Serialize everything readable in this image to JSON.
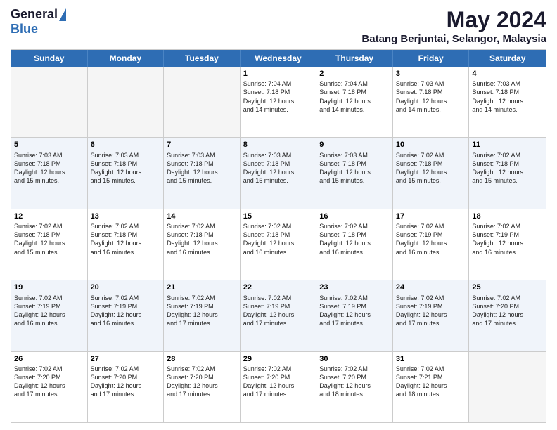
{
  "logo": {
    "general": "General",
    "blue": "Blue"
  },
  "title": "May 2024",
  "subtitle": "Batang Berjuntai, Selangor, Malaysia",
  "days": [
    "Sunday",
    "Monday",
    "Tuesday",
    "Wednesday",
    "Thursday",
    "Friday",
    "Saturday"
  ],
  "rows": [
    [
      {
        "day": "",
        "empty": true
      },
      {
        "day": "",
        "empty": true
      },
      {
        "day": "",
        "empty": true
      },
      {
        "day": "1",
        "lines": [
          "Sunrise: 7:04 AM",
          "Sunset: 7:18 PM",
          "Daylight: 12 hours",
          "and 14 minutes."
        ]
      },
      {
        "day": "2",
        "lines": [
          "Sunrise: 7:04 AM",
          "Sunset: 7:18 PM",
          "Daylight: 12 hours",
          "and 14 minutes."
        ]
      },
      {
        "day": "3",
        "lines": [
          "Sunrise: 7:03 AM",
          "Sunset: 7:18 PM",
          "Daylight: 12 hours",
          "and 14 minutes."
        ]
      },
      {
        "day": "4",
        "lines": [
          "Sunrise: 7:03 AM",
          "Sunset: 7:18 PM",
          "Daylight: 12 hours",
          "and 14 minutes."
        ]
      }
    ],
    [
      {
        "day": "5",
        "lines": [
          "Sunrise: 7:03 AM",
          "Sunset: 7:18 PM",
          "Daylight: 12 hours",
          "and 15 minutes."
        ]
      },
      {
        "day": "6",
        "lines": [
          "Sunrise: 7:03 AM",
          "Sunset: 7:18 PM",
          "Daylight: 12 hours",
          "and 15 minutes."
        ]
      },
      {
        "day": "7",
        "lines": [
          "Sunrise: 7:03 AM",
          "Sunset: 7:18 PM",
          "Daylight: 12 hours",
          "and 15 minutes."
        ]
      },
      {
        "day": "8",
        "lines": [
          "Sunrise: 7:03 AM",
          "Sunset: 7:18 PM",
          "Daylight: 12 hours",
          "and 15 minutes."
        ]
      },
      {
        "day": "9",
        "lines": [
          "Sunrise: 7:03 AM",
          "Sunset: 7:18 PM",
          "Daylight: 12 hours",
          "and 15 minutes."
        ]
      },
      {
        "day": "10",
        "lines": [
          "Sunrise: 7:02 AM",
          "Sunset: 7:18 PM",
          "Daylight: 12 hours",
          "and 15 minutes."
        ]
      },
      {
        "day": "11",
        "lines": [
          "Sunrise: 7:02 AM",
          "Sunset: 7:18 PM",
          "Daylight: 12 hours",
          "and 15 minutes."
        ]
      }
    ],
    [
      {
        "day": "12",
        "lines": [
          "Sunrise: 7:02 AM",
          "Sunset: 7:18 PM",
          "Daylight: 12 hours",
          "and 15 minutes."
        ]
      },
      {
        "day": "13",
        "lines": [
          "Sunrise: 7:02 AM",
          "Sunset: 7:18 PM",
          "Daylight: 12 hours",
          "and 16 minutes."
        ]
      },
      {
        "day": "14",
        "lines": [
          "Sunrise: 7:02 AM",
          "Sunset: 7:18 PM",
          "Daylight: 12 hours",
          "and 16 minutes."
        ]
      },
      {
        "day": "15",
        "lines": [
          "Sunrise: 7:02 AM",
          "Sunset: 7:18 PM",
          "Daylight: 12 hours",
          "and 16 minutes."
        ]
      },
      {
        "day": "16",
        "lines": [
          "Sunrise: 7:02 AM",
          "Sunset: 7:18 PM",
          "Daylight: 12 hours",
          "and 16 minutes."
        ]
      },
      {
        "day": "17",
        "lines": [
          "Sunrise: 7:02 AM",
          "Sunset: 7:19 PM",
          "Daylight: 12 hours",
          "and 16 minutes."
        ]
      },
      {
        "day": "18",
        "lines": [
          "Sunrise: 7:02 AM",
          "Sunset: 7:19 PM",
          "Daylight: 12 hours",
          "and 16 minutes."
        ]
      }
    ],
    [
      {
        "day": "19",
        "lines": [
          "Sunrise: 7:02 AM",
          "Sunset: 7:19 PM",
          "Daylight: 12 hours",
          "and 16 minutes."
        ]
      },
      {
        "day": "20",
        "lines": [
          "Sunrise: 7:02 AM",
          "Sunset: 7:19 PM",
          "Daylight: 12 hours",
          "and 16 minutes."
        ]
      },
      {
        "day": "21",
        "lines": [
          "Sunrise: 7:02 AM",
          "Sunset: 7:19 PM",
          "Daylight: 12 hours",
          "and 17 minutes."
        ]
      },
      {
        "day": "22",
        "lines": [
          "Sunrise: 7:02 AM",
          "Sunset: 7:19 PM",
          "Daylight: 12 hours",
          "and 17 minutes."
        ]
      },
      {
        "day": "23",
        "lines": [
          "Sunrise: 7:02 AM",
          "Sunset: 7:19 PM",
          "Daylight: 12 hours",
          "and 17 minutes."
        ]
      },
      {
        "day": "24",
        "lines": [
          "Sunrise: 7:02 AM",
          "Sunset: 7:19 PM",
          "Daylight: 12 hours",
          "and 17 minutes."
        ]
      },
      {
        "day": "25",
        "lines": [
          "Sunrise: 7:02 AM",
          "Sunset: 7:20 PM",
          "Daylight: 12 hours",
          "and 17 minutes."
        ]
      }
    ],
    [
      {
        "day": "26",
        "lines": [
          "Sunrise: 7:02 AM",
          "Sunset: 7:20 PM",
          "Daylight: 12 hours",
          "and 17 minutes."
        ]
      },
      {
        "day": "27",
        "lines": [
          "Sunrise: 7:02 AM",
          "Sunset: 7:20 PM",
          "Daylight: 12 hours",
          "and 17 minutes."
        ]
      },
      {
        "day": "28",
        "lines": [
          "Sunrise: 7:02 AM",
          "Sunset: 7:20 PM",
          "Daylight: 12 hours",
          "and 17 minutes."
        ]
      },
      {
        "day": "29",
        "lines": [
          "Sunrise: 7:02 AM",
          "Sunset: 7:20 PM",
          "Daylight: 12 hours",
          "and 17 minutes."
        ]
      },
      {
        "day": "30",
        "lines": [
          "Sunrise: 7:02 AM",
          "Sunset: 7:20 PM",
          "Daylight: 12 hours",
          "and 18 minutes."
        ]
      },
      {
        "day": "31",
        "lines": [
          "Sunrise: 7:02 AM",
          "Sunset: 7:21 PM",
          "Daylight: 12 hours",
          "and 18 minutes."
        ]
      },
      {
        "day": "",
        "empty": true
      }
    ]
  ]
}
